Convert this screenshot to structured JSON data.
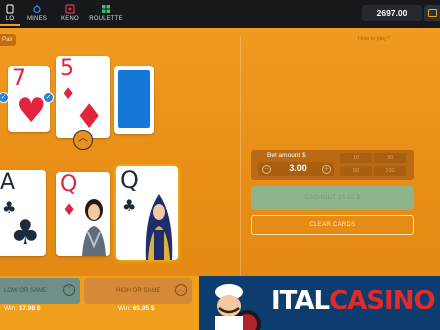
{
  "nav": {
    "hilo_label": "LO",
    "mines_label": "MINES",
    "keno_label": "KENO",
    "roulette_label": "ROULETTE"
  },
  "balance": "2697.00",
  "game": {
    "pair_tab": "Pair",
    "how_to_play": "How to play?",
    "history_cards": [
      {
        "rank": "7",
        "suit": "♥",
        "color": "#e2253c"
      },
      {
        "rank": "5",
        "suit": "♦",
        "color": "#e2253c"
      }
    ],
    "hand_cards": [
      {
        "rank": "A",
        "suit": "♣",
        "color": "#1a2b3e"
      },
      {
        "rank": "Q",
        "suit": "♦",
        "color": "#e2253c"
      },
      {
        "rank": "Q",
        "suit": "♣",
        "color": "#1a2b3e"
      }
    ]
  },
  "bet": {
    "label": "Bet amount $",
    "value": "3.00",
    "minus": "−",
    "plus": "+",
    "quick_amounts": [
      "10",
      "30",
      "50",
      "100"
    ],
    "cashout_label": "CASHOUT 15.02 $",
    "clear_cards_label": "CLEAR CARDS"
  },
  "buttons": {
    "low_label": "LOW OR SAME",
    "high_label": "HIGH OR SAME",
    "low_win_prefix": "Win:",
    "low_win_value": "17.98 $",
    "high_win_prefix": "Win:",
    "high_win_value": "65.95 $"
  },
  "banner": {
    "brand_white": "ITAL",
    "brand_red": "CASINO"
  },
  "colors": {
    "accent": "#e8961c",
    "topbar": "#16181c",
    "card_red": "#e2253c",
    "card_back": "#1677d8",
    "banner": "#0d3c6e"
  }
}
